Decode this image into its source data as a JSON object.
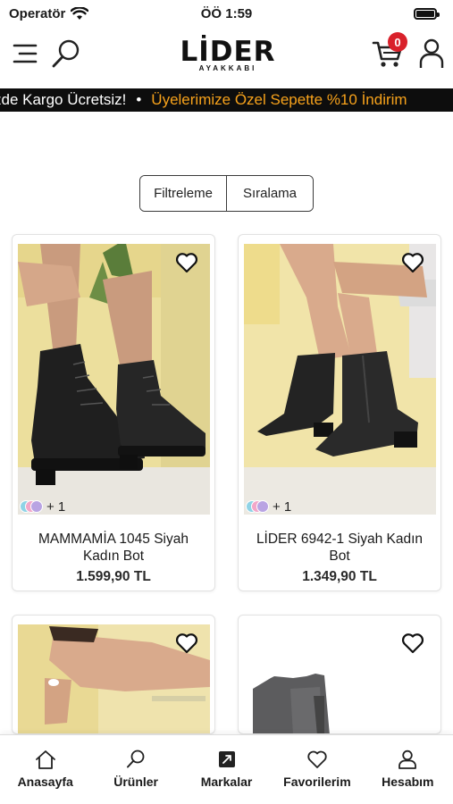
{
  "status_bar": {
    "carrier": "Operatör",
    "time": "ÖÖ 1:59",
    "battery_level": 0.9
  },
  "header": {
    "logo_text": "LİDER",
    "logo_subtext": "AYAKKABI",
    "cart_count": "0",
    "icons": [
      "menu-icon",
      "search-icon",
      "cart-icon",
      "account-icon"
    ]
  },
  "announcement": {
    "items": [
      "inizde Kargo Ücretsiz!",
      "•",
      "Üyelerimize Özel Sepette %10 İndirim"
    ]
  },
  "toolbar": {
    "filter_label": "Filtreleme",
    "sort_label": "Sıralama"
  },
  "products": [
    {
      "name": "MAMMAMİA 1045 Siyah Kadın Bot",
      "price": "1.599,90 TL",
      "color_count": "+ 1"
    },
    {
      "name": "LİDER 6942-1 Siyah Kadın Bot",
      "price": "1.349,90 TL",
      "color_count": "+ 1"
    },
    {
      "name": "",
      "price": "",
      "color_count": ""
    },
    {
      "name": "",
      "price": "",
      "color_count": ""
    }
  ],
  "tabbar": {
    "items": [
      {
        "label": "Anasayfa",
        "icon": "home-icon"
      },
      {
        "label": "Ürünler",
        "icon": "search-icon"
      },
      {
        "label": "Markalar",
        "icon": "brand-icon"
      },
      {
        "label": "Favorilerim",
        "icon": "heart-icon"
      },
      {
        "label": "Hesabım",
        "icon": "account-icon"
      }
    ]
  },
  "colors": {
    "accent_orange": "#f7a21b",
    "badge_red": "#d9212b",
    "announcement_bg": "#0d0d0d"
  }
}
